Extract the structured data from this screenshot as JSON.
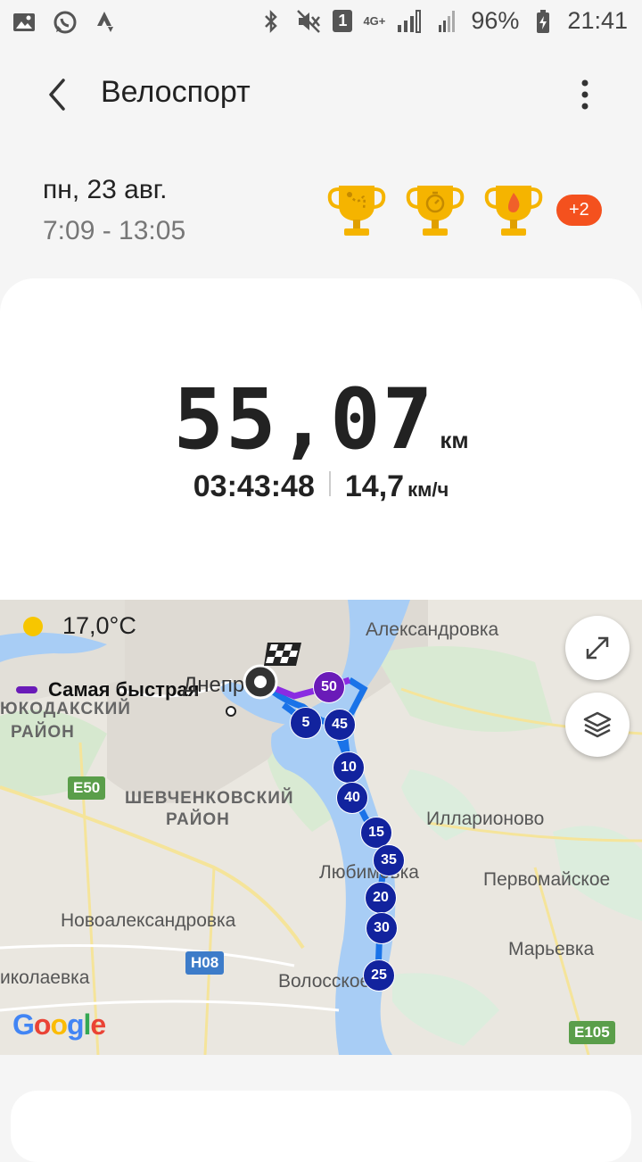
{
  "status_bar": {
    "battery": "96%",
    "time": "21:41",
    "network": "4G+",
    "sim": "1"
  },
  "header": {
    "title": "Велоспорт"
  },
  "workout": {
    "date": "пн, 23 авг.",
    "time_range": "7:09 - 13:05",
    "achievements_extra": "+2",
    "distance": "55,07",
    "distance_unit": "км",
    "duration": "03:43:48",
    "avg_speed": "14,7",
    "speed_unit": "км/ч"
  },
  "map": {
    "temperature": "17,0°C",
    "legend_label": "Самая быстрая",
    "legend_color": "#6a1bb8",
    "route_color": "#1a73e8",
    "labels": {
      "aleksandrovka": "Александровка",
      "dnipro": "Днепр",
      "district_left_1": "ЮКОДАКСКИЙ",
      "district_left_2": "РАЙОН",
      "shevchenko_1": "ШЕВЧЕНКОВСКИЙ",
      "shevchenko_2": "РАЙОН",
      "illarionovo": "Илларионово",
      "lyubimovka": "Любимовка",
      "pervomayskoe": "Первомайское",
      "novoaleksandrovka": "Новоалександровка",
      "maryevka": "Марьевка",
      "nikolaevka": "иколаевка",
      "voloske": "Волосское"
    },
    "road_signs": {
      "e50": "E50",
      "h08": "H08",
      "e105": "E105"
    },
    "km_markers": [
      "5",
      "10",
      "15",
      "20",
      "25",
      "30",
      "35",
      "40",
      "45",
      "50"
    ],
    "attribution": "Google"
  }
}
